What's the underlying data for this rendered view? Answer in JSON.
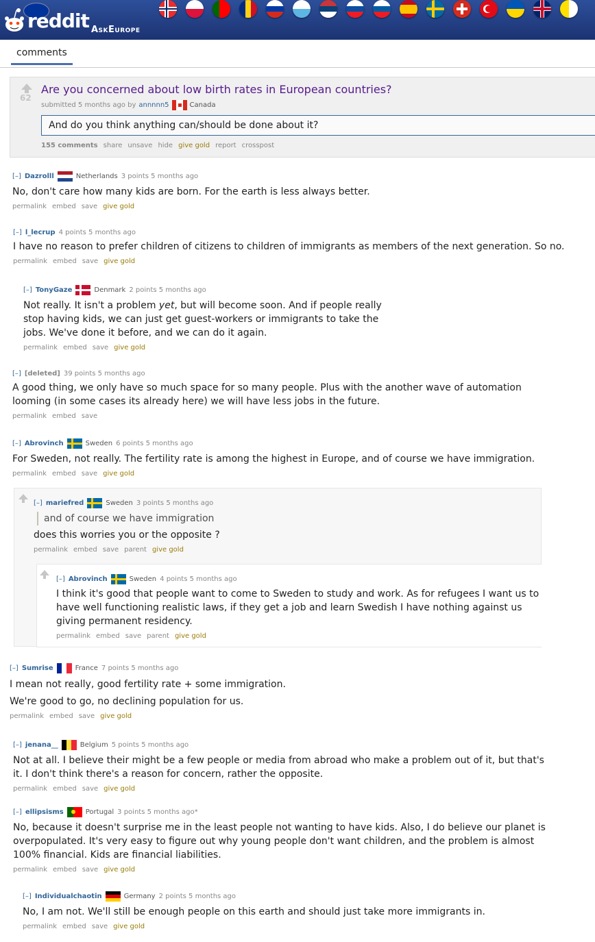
{
  "header": {
    "logo_text": "reddit",
    "subreddit": "AskEurope",
    "colors": {
      "bar": "#1f3a7a",
      "link": "#336699",
      "visited_title": "#551a8b",
      "gold": "#9a7d0a"
    }
  },
  "tabs": [
    {
      "label": "comments"
    }
  ],
  "post": {
    "score": "62",
    "title": "Are you concerned about low birth rates in European countries?",
    "submitted": "submitted 5 months ago by",
    "author": "annnnn5",
    "flair": "Canada",
    "selftext": "And do you think anything can/should be done about it?",
    "buttons": {
      "comments": "155 comments",
      "share": "share",
      "unsave": "unsave",
      "hide": "hide",
      "give_gold": "give gold",
      "report": "report",
      "crosspost": "crosspost"
    }
  },
  "labels": {
    "toggle": "[–]",
    "permalink": "permalink",
    "embed": "embed",
    "save": "save",
    "parent": "parent",
    "give_gold": "give gold"
  },
  "comments": [
    {
      "author": "Dazrolll",
      "flair": "Netherlands",
      "meta": "3 points 5 months ago",
      "body": "No, don't care how many kids are born. For the earth is less always better."
    },
    {
      "author": "l_lecrup",
      "flair": "",
      "meta": "4 points 5 months ago",
      "body": "I have no reason to prefer children of citizens to children of immigrants as members of the next generation. So no."
    },
    {
      "author": "TonyGaze",
      "flair": "Denmark",
      "meta": "2 points 5 months ago",
      "body_pre": "Not really. It isn't a problem ",
      "body_em": "yet",
      "body_post": ", but will become soon. And if people really stop having kids, we can just get guest-workers or immigrants to take the jobs. We've done it before, and we can do it again."
    },
    {
      "author": "[deleted]",
      "flair": "",
      "meta": "39 points 5 months ago",
      "body": "A good thing, we only have so much space for so many people. Plus with the another wave of automation looming (in some cases its already here) we will have less jobs in the future."
    },
    {
      "author": "Abrovinch",
      "flair": "Sweden",
      "meta": "6 points 5 months ago",
      "body": "For Sweden, not really. The fertility rate is among the highest in Europe, and of course we have immigration."
    },
    {
      "author": "mariefred",
      "flair": "Sweden",
      "meta": "3 points 5 months ago",
      "quote": "and of course we have immigration",
      "body": "does this worries you or the opposite ?"
    },
    {
      "author": "Abrovinch",
      "flair": "Sweden",
      "meta": "4 points 5 months ago",
      "body": "I think it's good that people want to come to Sweden to study and work. As for refugees I want us to have well functioning realistic laws, if they get a job and learn Swedish I have nothing against us giving permanent residency."
    },
    {
      "author": "Sumrise",
      "flair": "France",
      "meta": "7 points 5 months ago",
      "body": "I mean not really, good fertility rate + some immigration.",
      "body2": "We're good to go, no declining population for us."
    },
    {
      "author": "jenana__",
      "flair": "Belgium",
      "meta": "5 points 5 months ago",
      "body": "Not at all. I believe their might be a few people or media from abroad who make a problem out of it, but that's it. I don't think there's a reason for concern, rather the opposite."
    },
    {
      "author": "ellipsisms",
      "flair": "Portugal",
      "meta": "3 points 5 months ago*",
      "body": "No, because it doesn't surprise me in the least people not wanting to have kids. Also, I do believe our planet is overpopulated. It's very easy to figure out why young people don't want children, and the problem is almost 100% financial. Kids are financial liabilities."
    },
    {
      "author": "Individualchaotin",
      "flair": "Germany",
      "meta": "2 points 5 months ago",
      "body": "No, I am not. We'll still be enough people on this earth and should just take more immigrants in."
    }
  ]
}
